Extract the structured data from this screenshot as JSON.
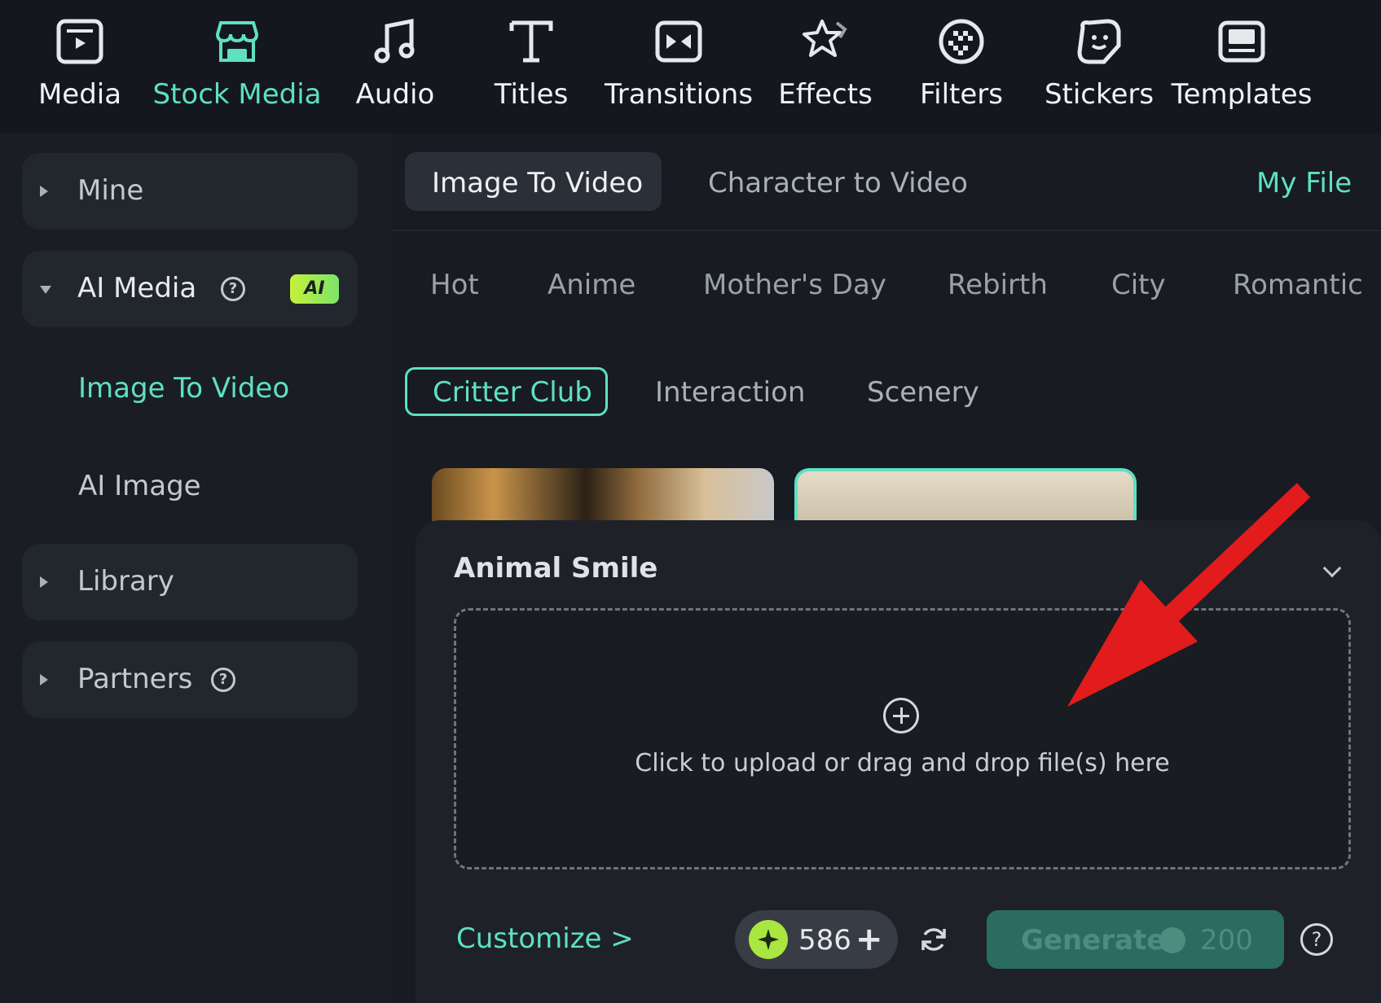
{
  "toolbar": {
    "items": [
      {
        "label": "Media",
        "icon": "media-icon"
      },
      {
        "label": "Stock Media",
        "icon": "stock-media-icon",
        "active": true
      },
      {
        "label": "Audio",
        "icon": "music-note-icon"
      },
      {
        "label": "Titles",
        "icon": "text-t-icon"
      },
      {
        "label": "Transitions",
        "icon": "transitions-icon"
      },
      {
        "label": "Effects",
        "icon": "effects-star-icon"
      },
      {
        "label": "Filters",
        "icon": "filters-icon"
      },
      {
        "label": "Stickers",
        "icon": "sticker-icon"
      },
      {
        "label": "Templates",
        "icon": "templates-icon"
      }
    ]
  },
  "sidebar": {
    "mine": "Mine",
    "ai_media": "AI Media",
    "ai_badge": "AI",
    "image_to_video": "Image To Video",
    "ai_image": "AI Image",
    "library": "Library",
    "partners": "Partners"
  },
  "main": {
    "tabs": [
      "Image To Video",
      "Character to Video"
    ],
    "my_file": "My File",
    "categories": [
      "Hot",
      "Anime",
      "Mother's Day",
      "Rebirth",
      "City",
      "Romantic"
    ],
    "subcategories": [
      "Critter Club",
      "Interaction",
      "Scenery"
    ]
  },
  "panel": {
    "title": "Animal Smile",
    "upload_text": "Click to upload or drag and drop file(s) here",
    "customize": "Customize >",
    "credits": "586",
    "credits_plus": "+",
    "generate_label": "Generate",
    "generate_cost": "200",
    "help": "?"
  },
  "colors": {
    "accent": "#5ee0c3",
    "background": "#181b21",
    "arrow": "#e21c1c"
  }
}
